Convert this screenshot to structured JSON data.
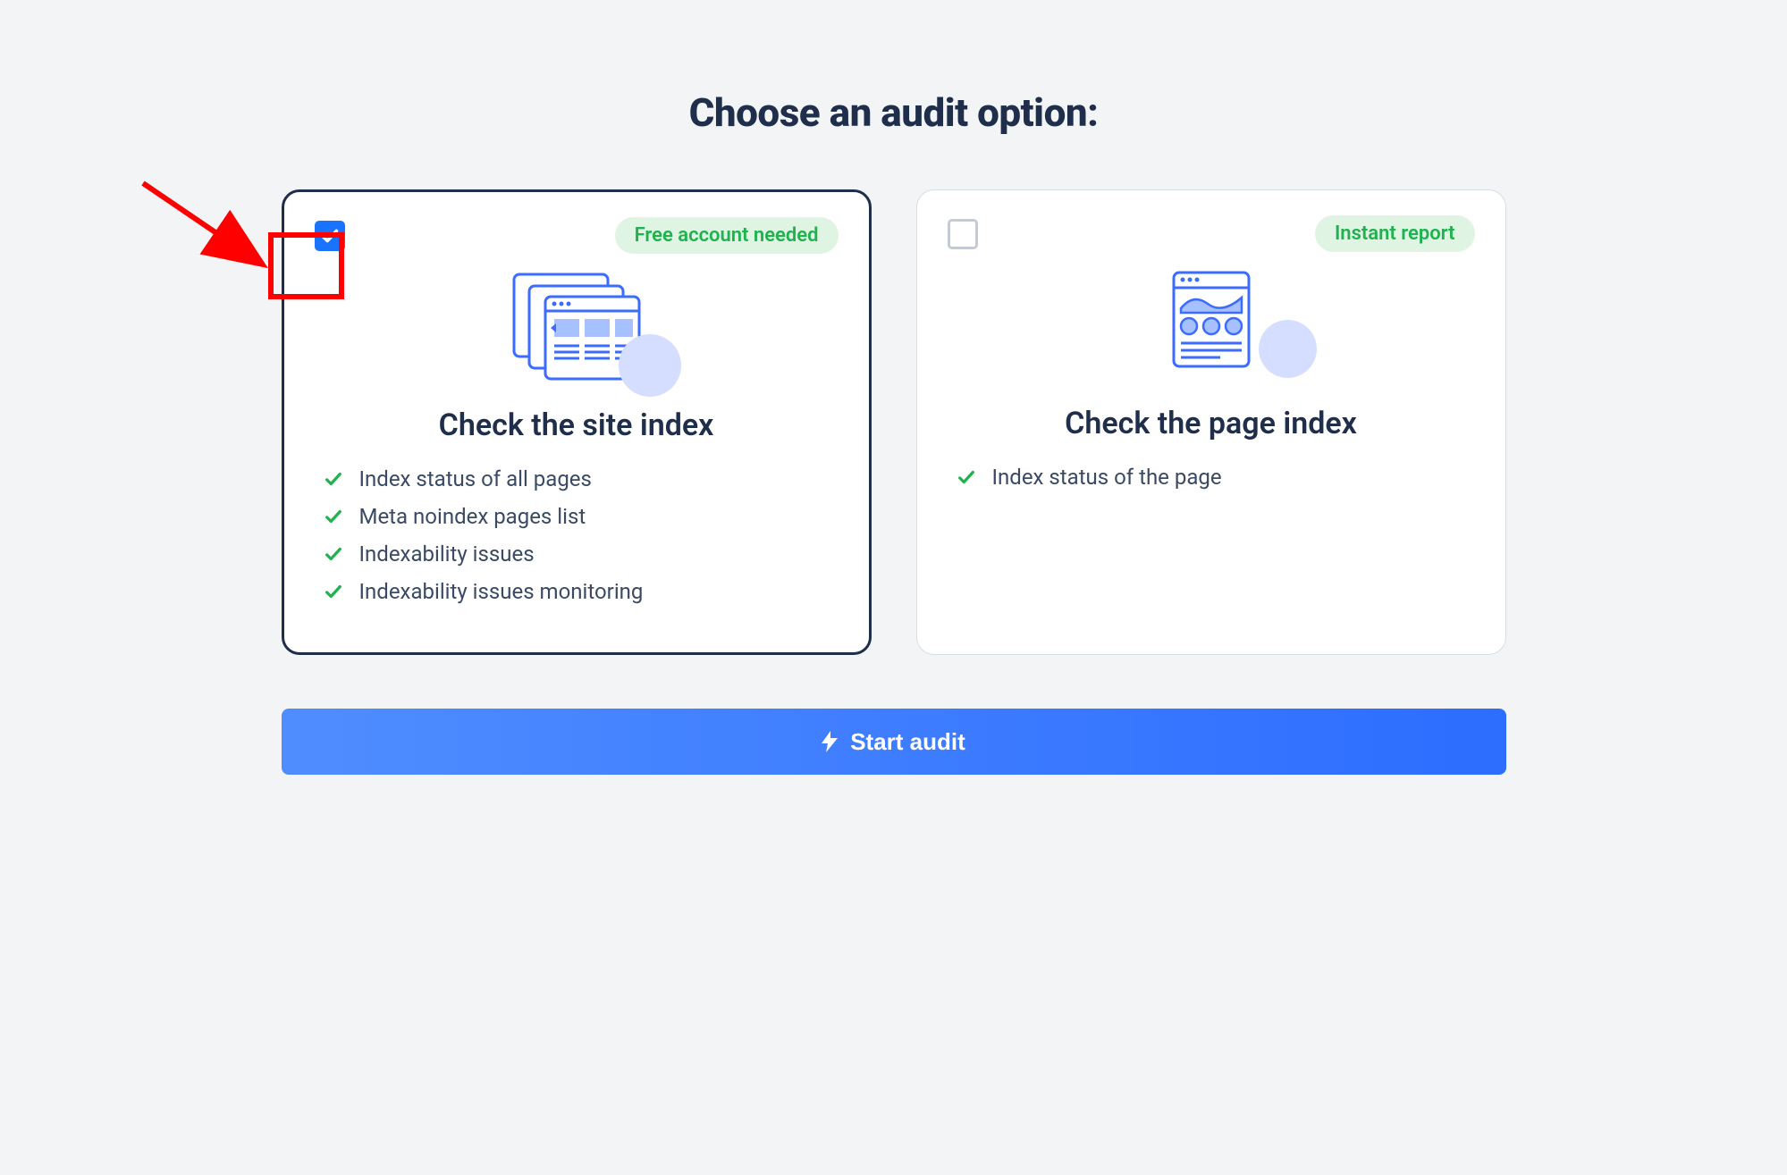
{
  "title": "Choose an audit option:",
  "cards": [
    {
      "selected": true,
      "badge": "Free account needed",
      "title": "Check the site index",
      "features": [
        "Index status of all pages",
        "Meta noindex pages list",
        "Indexability issues",
        "Indexability issues monitoring"
      ]
    },
    {
      "selected": false,
      "badge": "Instant report",
      "title": "Check the page index",
      "features": [
        "Index status of the page"
      ]
    }
  ],
  "start_button": "Start audit"
}
